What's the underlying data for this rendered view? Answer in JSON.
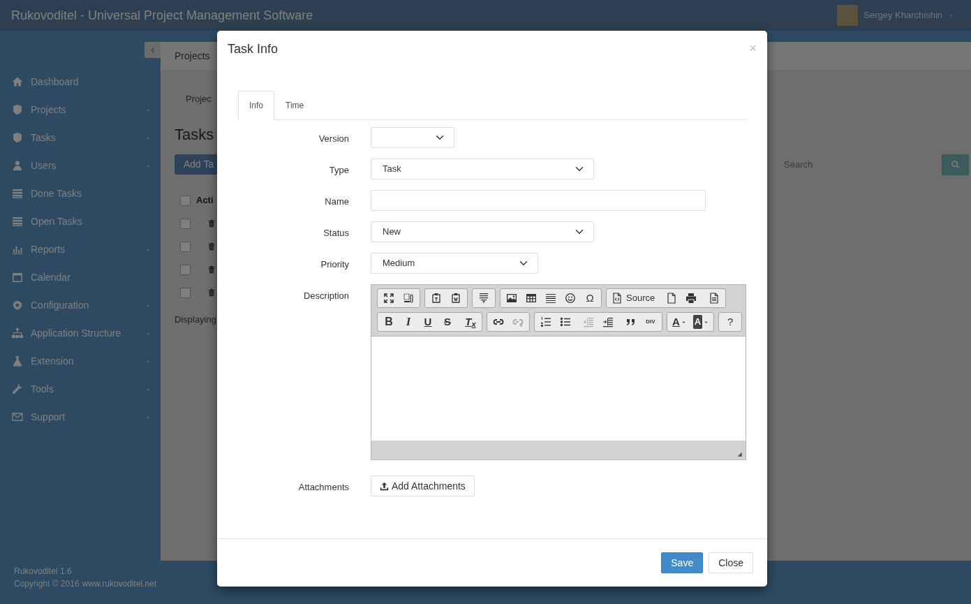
{
  "app": {
    "title": "Rukovoditel - Universal Project Management Software",
    "user": "Sergey Kharchishin"
  },
  "sidebar": {
    "items": [
      {
        "label": "Dashboard",
        "kind": "home",
        "expandable": false
      },
      {
        "label": "Projects",
        "kind": "shield",
        "expandable": true
      },
      {
        "label": "Tasks",
        "kind": "shield",
        "expandable": true
      },
      {
        "label": "Users",
        "kind": "user",
        "expandable": true
      },
      {
        "label": "Done Tasks",
        "kind": "list",
        "expandable": false
      },
      {
        "label": "Open Tasks",
        "kind": "list",
        "expandable": false
      },
      {
        "label": "Reports",
        "kind": "chart",
        "expandable": true
      },
      {
        "label": "Calendar",
        "kind": "calendar",
        "expandable": false
      },
      {
        "label": "Configuration",
        "kind": "gear",
        "expandable": true
      },
      {
        "label": "Application Structure",
        "kind": "sitemap",
        "expandable": true
      },
      {
        "label": "Extension",
        "kind": "flask",
        "expandable": true
      },
      {
        "label": "Tools",
        "kind": "wrench",
        "expandable": true
      },
      {
        "label": "Support",
        "kind": "envelope",
        "expandable": true
      }
    ],
    "footer": {
      "version": "Rukovoditel 1.6",
      "copyright": "Copyright © 2016",
      "link": "www.rukovoditel.net"
    }
  },
  "page": {
    "breadcrumb": "Projects",
    "tab": "Projec",
    "heading": "Tasks",
    "add_button": "Add Ta",
    "search": {
      "placeholder": "Search"
    },
    "table": {
      "header": {
        "label": "Acti",
        "checked": false
      },
      "rows": [
        {
          "checked": false
        },
        {
          "checked": false
        },
        {
          "checked": false
        },
        {
          "checked": false
        }
      ]
    },
    "listing_info": "Displaying"
  },
  "modal": {
    "title": "Task Info",
    "close": "×",
    "tabs": [
      {
        "label": "Info",
        "selected": true
      },
      {
        "label": "Time",
        "selected": false
      }
    ],
    "fields": [
      {
        "label": "Version",
        "kind": "select"
      },
      {
        "label": "Type",
        "kind": "select",
        "value": "Task"
      },
      {
        "label": "Name",
        "kind": "text"
      },
      {
        "label": "Status",
        "kind": "select",
        "value": "New"
      },
      {
        "label": "Priority",
        "kind": "select",
        "value": "Medium"
      },
      {
        "label": "Description",
        "kind": "editor",
        "toolbar": [
          [
            [
              {
                "kind": "maximize",
                "disabled": false
              },
              {
                "kind": "showblocks",
                "disabled": false
              }
            ],
            [
              {
                "kind": "paste-text",
                "disabled": false
              },
              {
                "kind": "paste-word",
                "disabled": false
              }
            ],
            [
              {
                "kind": "templates",
                "disabled": false
              }
            ],
            [
              {
                "kind": "image",
                "disabled": false
              },
              {
                "kind": "table",
                "disabled": false
              },
              {
                "kind": "hrule",
                "disabled": false
              },
              {
                "kind": "smiley",
                "disabled": false
              },
              {
                "kind": "glyph",
                "text": "Ω",
                "disabled": false
              }
            ],
            [
              {
                "kind": "source",
                "text": "Source",
                "disabled": false
              },
              {
                "kind": "separator"
              },
              {
                "kind": "newpage",
                "disabled": false
              },
              {
                "kind": "print",
                "disabled": false
              },
              {
                "kind": "separator"
              },
              {
                "kind": "preview",
                "disabled": false
              }
            ]
          ],
          [
            [
              {
                "kind": "bold",
                "text": "B",
                "disabled": false
              },
              {
                "kind": "italic",
                "text": "I",
                "disabled": false
              },
              {
                "kind": "underline",
                "text": "U",
                "disabled": false
              },
              {
                "kind": "strike",
                "text": "S",
                "disabled": false
              },
              {
                "kind": "separator"
              },
              {
                "kind": "clear",
                "text": "T$_{x}$",
                "disabled": false
              }
            ],
            [
              {
                "kind": "link",
                "disabled": false
              },
              {
                "kind": "unlink",
                "disabled": true
              }
            ],
            [
              {
                "kind": "numlist",
                "disabled": false
              },
              {
                "kind": "bullist",
                "disabled": false
              },
              {
                "kind": "separator"
              },
              {
                "kind": "outdent",
                "disabled": true
              },
              {
                "kind": "indent",
                "disabled": false
              },
              {
                "kind": "separator"
              },
              {
                "kind": "quote",
                "disabled": false
              },
              {
                "kind": "div",
                "text": "DIV",
                "disabled": false
              }
            ],
            [
              {
                "kind": "textcolor",
                "text": "A",
                "disabled": false
              },
              {
                "kind": "bgcolor",
                "text": "A",
                "disabled": false
              }
            ],
            [
              {
                "kind": "glyph",
                "text": "?",
                "disabled": false
              }
            ]
          ]
        ]
      },
      {
        "label": "Attachments",
        "kind": "attachments",
        "button": "Add Attachments"
      }
    ],
    "buttons": [
      {
        "label": "Save",
        "kind": "primary"
      },
      {
        "label": "Close",
        "kind": "default"
      }
    ]
  }
}
